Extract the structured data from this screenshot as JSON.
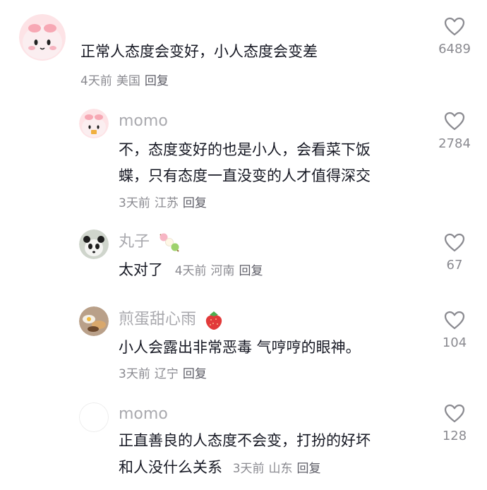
{
  "comments": [
    {
      "username": "",
      "text_lines": [
        "正常人态度会变好，小人态度会变差"
      ],
      "time": "4天前",
      "location": "美国",
      "reply_label": "回复",
      "likes": "6489"
    },
    {
      "username": "momo",
      "text_lines": [
        "不，态度变好的也是小人，会看菜下饭",
        "蝶，只有态度一直没变的人才值得深交"
      ],
      "time": "3天前",
      "location": "江苏",
      "reply_label": "回复",
      "likes": "2784"
    },
    {
      "username": "丸子",
      "text_lines": [
        "太对了"
      ],
      "time": "4天前",
      "location": "河南",
      "reply_label": "回复",
      "likes": "67"
    },
    {
      "username": "煎蛋甜心雨",
      "text_lines": [
        "小人会露出非常恶毒 气哼哼的眼神。"
      ],
      "time": "3天前",
      "location": "辽宁",
      "reply_label": "回复",
      "likes": "104"
    },
    {
      "username": "momo",
      "text_lines": [
        "正直善良的人态度不会变，打扮的好坏",
        "和人没什么关系"
      ],
      "time": "3天前",
      "location": "山东",
      "reply_label": "回复",
      "likes": "128"
    }
  ],
  "icons": {
    "like": "heart-outline-icon",
    "dango": "dango-emoji-icon",
    "strawberry": "strawberry-emoji-icon"
  },
  "colors": {
    "text": "#161823",
    "muted": "#8a8a90",
    "username": "#a9a9ae"
  }
}
